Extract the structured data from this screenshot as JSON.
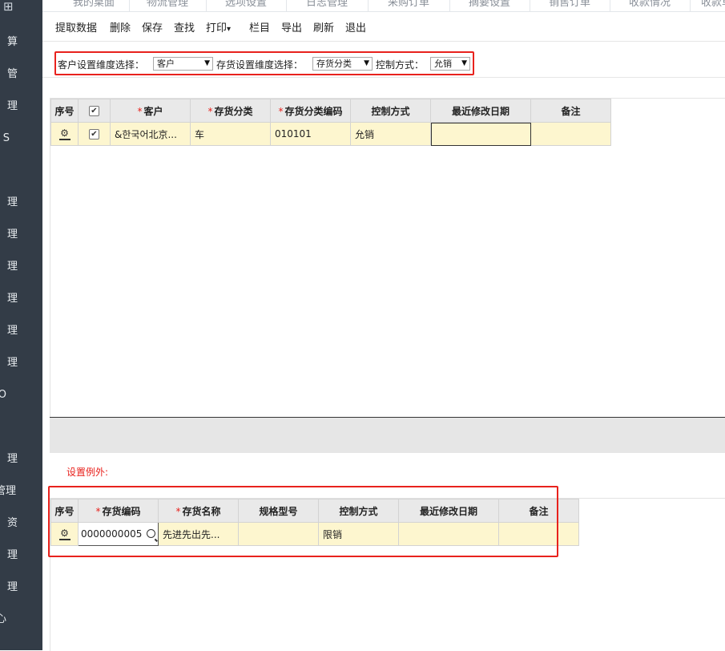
{
  "sidebar": {
    "items": [
      "算",
      "管",
      "理",
      "S",
      "理",
      "理",
      "理",
      "理",
      "理",
      "理",
      "O",
      "理",
      "管理",
      "资",
      "理",
      "理",
      "心"
    ]
  },
  "tabs": [
    "我的桌面",
    "物流管理",
    "选项设置",
    "日志管理",
    "采购订单",
    "摘要设置",
    "销售订单",
    "收款情况",
    "收款单"
  ],
  "toolbar": {
    "fetch": "提取数据",
    "delete": "删除",
    "save": "保存",
    "find": "查找",
    "print": "打印",
    "columns": "栏目",
    "export": "导出",
    "refresh": "刷新",
    "exit": "退出"
  },
  "filters": {
    "customer_dim_label": "客户设置维度选择：",
    "customer_dim_value": "客户",
    "inventory_dim_label": "存货设置维度选择：",
    "inventory_dim_value": "存货分类",
    "control_label": "控制方式：",
    "control_value": "允销"
  },
  "grid1": {
    "headers": {
      "seq": "序号",
      "customer": "客户",
      "inv_class": "存货分类",
      "inv_class_code": "存货分类编码",
      "control": "控制方式",
      "last_modified": "最近修改日期",
      "remark": "备注"
    },
    "rows": [
      {
        "customer": "&한국어北京...",
        "inv_class": "车",
        "inv_class_code": "010101",
        "control": "允销",
        "last_modified": "",
        "remark": ""
      }
    ]
  },
  "exceptions": {
    "label": "设置例外:"
  },
  "grid2": {
    "headers": {
      "seq": "序号",
      "inv_code": "存货编码",
      "inv_name": "存货名称",
      "spec": "规格型号",
      "control": "控制方式",
      "last_modified": "最近修改日期",
      "remark": "备注"
    },
    "rows": [
      {
        "inv_code": "0000000005",
        "inv_name": "先进先出先...",
        "spec": "",
        "control": "限销",
        "last_modified": "",
        "remark": ""
      }
    ]
  },
  "colors": {
    "sidebar_bg": "#333c47",
    "highlight_red": "#e8221d",
    "row_yellow": "#fdf6cf",
    "header_gray": "#e9e9e9"
  }
}
